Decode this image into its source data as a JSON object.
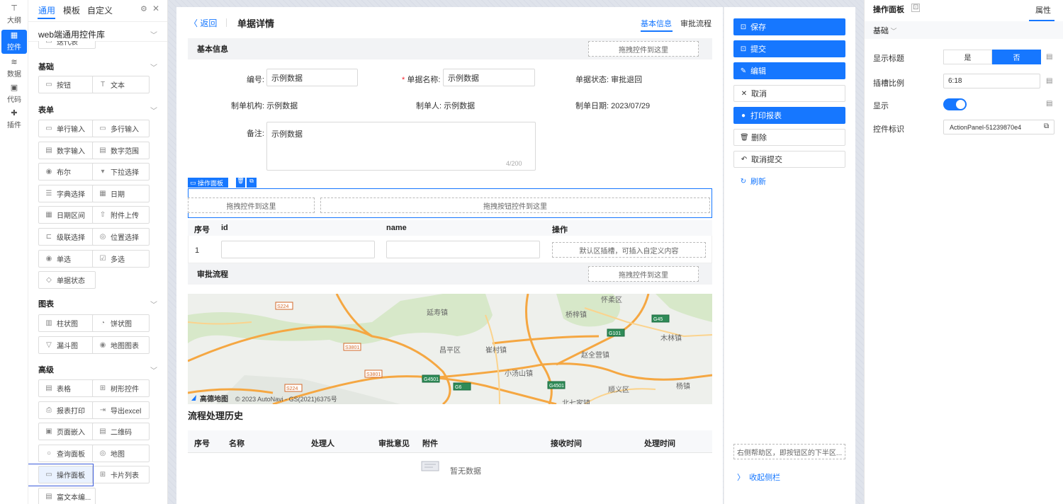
{
  "rail": {
    "items": [
      {
        "label": "大纲",
        "glyph": "⊤"
      },
      {
        "label": "控件",
        "glyph": "▦"
      },
      {
        "label": "数据",
        "glyph": "≋"
      },
      {
        "label": "代码",
        "glyph": "▣"
      },
      {
        "label": "插件",
        "glyph": "✚"
      }
    ]
  },
  "palette": {
    "tabs": [
      "通用",
      "模板",
      "自定义"
    ],
    "library": "web端通用控件库",
    "partial_item": "迭代表",
    "sections": {
      "basic": "基础",
      "form": "表单",
      "chart": "图表",
      "advanced": "高级"
    },
    "basic": [
      {
        "label": "按钮",
        "icon": "▭"
      },
      {
        "label": "文本",
        "icon": "T"
      }
    ],
    "form": [
      {
        "label": "单行输入",
        "icon": "▭"
      },
      {
        "label": "多行输入",
        "icon": "▭"
      },
      {
        "label": "数字输入",
        "icon": "▤"
      },
      {
        "label": "数字范围",
        "icon": "▤"
      },
      {
        "label": "布尔",
        "icon": "◉"
      },
      {
        "label": "下拉选择",
        "icon": "▾"
      },
      {
        "label": "字典选择",
        "icon": "☰"
      },
      {
        "label": "日期",
        "icon": "▦"
      },
      {
        "label": "日期区间",
        "icon": "▦"
      },
      {
        "label": "附件上传",
        "icon": "⇧"
      },
      {
        "label": "级联选择",
        "icon": "⊏"
      },
      {
        "label": "位置选择",
        "icon": "◎"
      },
      {
        "label": "单选",
        "icon": "◉"
      },
      {
        "label": "多选",
        "icon": "☑"
      },
      {
        "label": "单据状态",
        "icon": "◇"
      }
    ],
    "chart": [
      {
        "label": "柱状图",
        "icon": "▥"
      },
      {
        "label": "饼状图",
        "icon": "◔"
      },
      {
        "label": "漏斗图",
        "icon": "▽"
      },
      {
        "label": "地图图表",
        "icon": "◉"
      }
    ],
    "advanced": [
      {
        "label": "表格",
        "icon": "▤"
      },
      {
        "label": "树形控件",
        "icon": "⊞"
      },
      {
        "label": "报表打印",
        "icon": "⎙"
      },
      {
        "label": "导出excel",
        "icon": "⇥"
      },
      {
        "label": "页面嵌入",
        "icon": "▣"
      },
      {
        "label": "二维码",
        "icon": "▤"
      },
      {
        "label": "查询面板",
        "icon": "○"
      },
      {
        "label": "地图",
        "icon": "◎"
      },
      {
        "label": "操作面板",
        "icon": "▭"
      },
      {
        "label": "卡片列表",
        "icon": "⊞"
      },
      {
        "label": "富文本编...",
        "icon": "▤"
      }
    ]
  },
  "form": {
    "back": "返回",
    "title": "单据详情",
    "tabs": [
      "基本信息",
      "审批流程"
    ],
    "basic_title": "基本信息",
    "drop": "拖拽控件到这里",
    "drop_btn": "拖拽按钮控件到这里",
    "fields": {
      "code_label": "编号:",
      "code_value": "示例数据",
      "name_label": "单据名称:",
      "name_value": "示例数据",
      "status": "单据状态: 审批退回",
      "org": "制单机构: 示例数据",
      "maker": "制单人: 示例数据",
      "date": "制单日期: 2023/07/29",
      "remark_label": "备注:",
      "remark_value": "示例数据",
      "remark_count": "4/200"
    },
    "panel_tag": "操作面板",
    "table": {
      "headers": [
        "序号",
        "id",
        "name",
        "操作"
      ],
      "row_no": "1",
      "slot": "默认区插槽，可插入自定义内容"
    },
    "approval_title": "审批流程",
    "map": {
      "credit": "© 2023 AutoNavi - GS(2021)6375号",
      "logo": "高德地图",
      "places": [
        "延寿镇",
        "桥梓镇",
        "怀柔区",
        "昌平区",
        "崔村镇",
        "木林镇",
        "赵全营镇",
        "小汤山镇",
        "顺义区",
        "杨镇",
        "北七家镇"
      ],
      "roads": [
        "S224",
        "G45",
        "G101",
        "S3801",
        "S3801",
        "G4501",
        "G6",
        "G4501",
        "S224"
      ]
    },
    "history_title": "流程处理历史",
    "history_headers": [
      "序号",
      "名称",
      "处理人",
      "审批意见",
      "附件",
      "接收时间",
      "处理时间"
    ],
    "empty": "暂无数据"
  },
  "actions": {
    "buttons": [
      {
        "label": "保存",
        "icon": "⊡",
        "style": "pri"
      },
      {
        "label": "提交",
        "icon": "⊡",
        "style": "pri"
      },
      {
        "label": "编辑",
        "icon": "✎",
        "style": "pri"
      },
      {
        "label": "取消",
        "icon": "✕",
        "style": "def"
      },
      {
        "label": "打印报表",
        "icon": "●",
        "style": "pri"
      },
      {
        "label": "删除",
        "icon": "🗑",
        "style": "def"
      },
      {
        "label": "取消提交",
        "icon": "↶",
        "style": "def"
      },
      {
        "label": "刷新",
        "icon": "↻",
        "style": "lnk"
      }
    ],
    "help_drop": "右侧帮助区，即按钮区的下半区...",
    "collapse": "收起侧栏"
  },
  "props": {
    "title": "操作面板",
    "tab": "属性",
    "group": "基础",
    "show_title_label": "显示标题",
    "yes": "是",
    "no": "否",
    "ratio_label": "插槽比例",
    "ratio_value": "6:18",
    "show_label": "显示",
    "id_label": "控件标识",
    "id_value": "ActionPanel-51239870e4"
  },
  "colors": {
    "accent": "#1677ff"
  }
}
